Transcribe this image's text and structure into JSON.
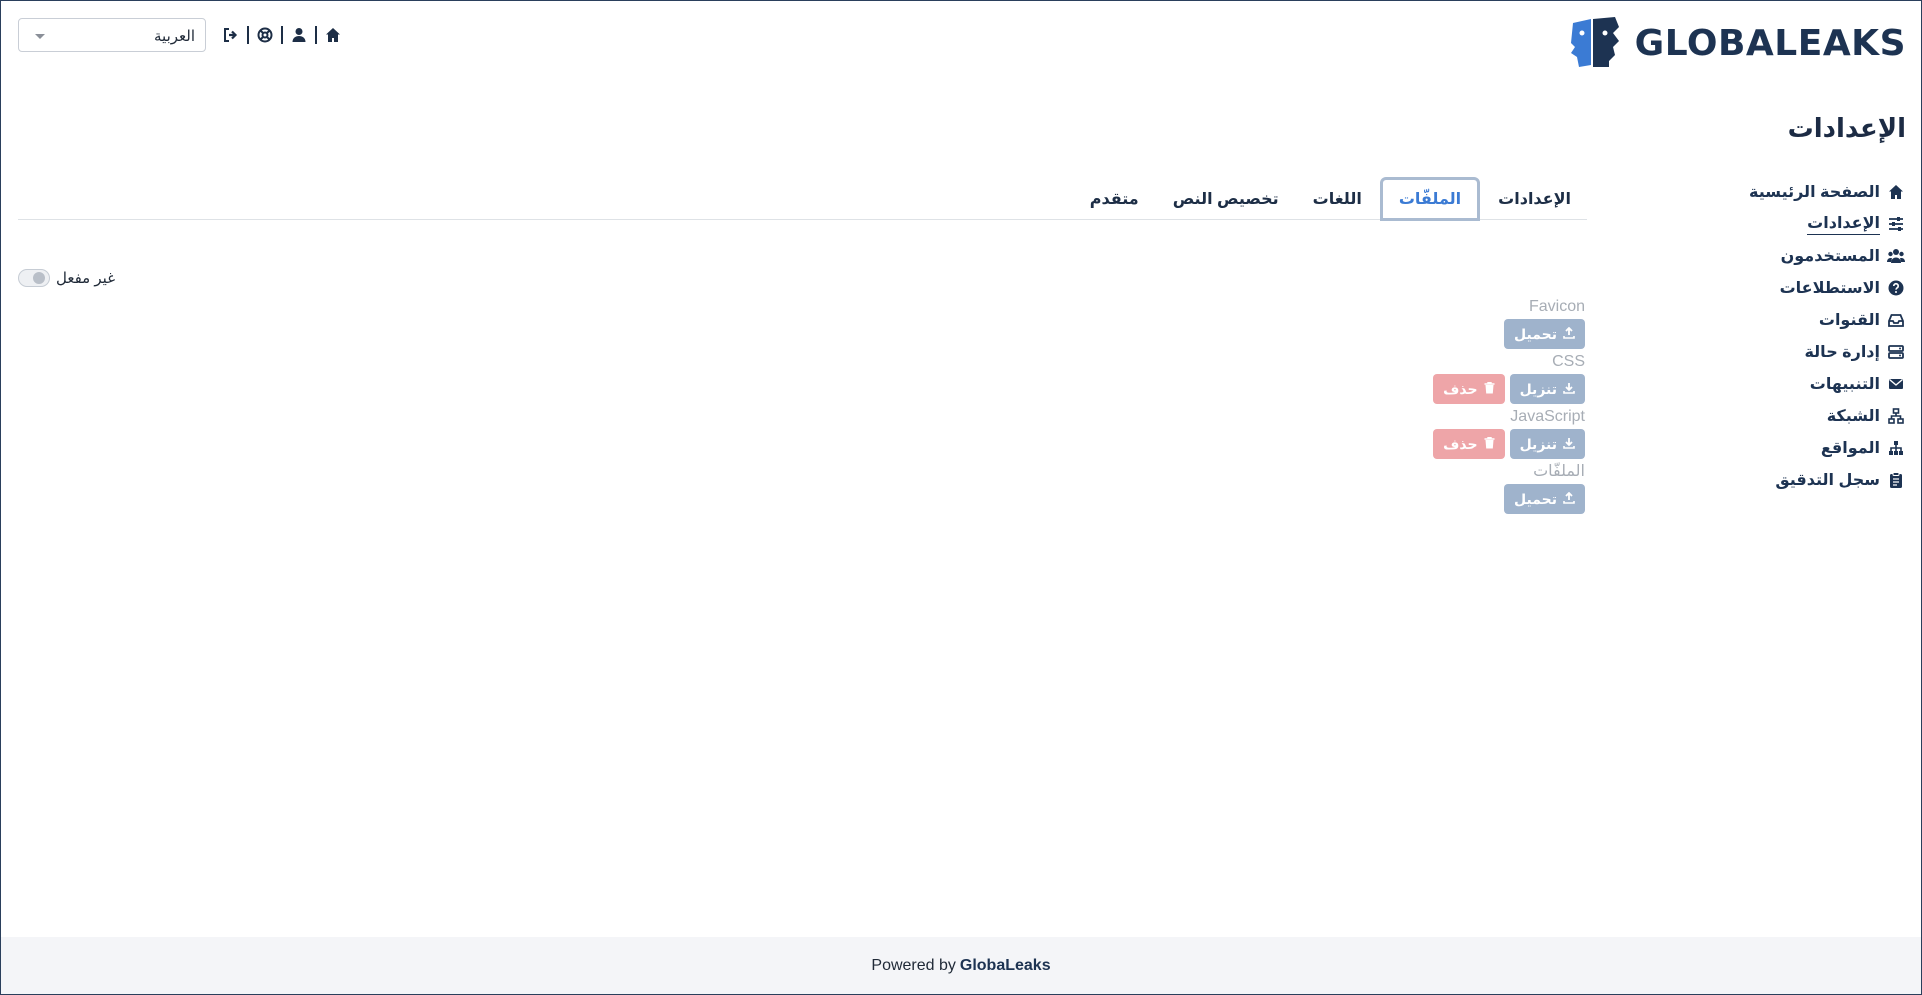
{
  "header": {
    "logo_text": "GLOBALEAKS",
    "language_select": {
      "value": "العربية"
    },
    "nav_icons": [
      "home-icon",
      "user-icon",
      "support-icon",
      "logout-icon"
    ]
  },
  "page_title": "الإعدادات",
  "sidebar": {
    "items": [
      {
        "label": "الصفحة الرئيسية",
        "icon": "home-icon"
      },
      {
        "label": "الإعدادات",
        "icon": "sliders-icon",
        "active": true
      },
      {
        "label": "المستخدمون",
        "icon": "users-icon"
      },
      {
        "label": "الاستطلاعات",
        "icon": "question-icon"
      },
      {
        "label": "القنوات",
        "icon": "inbox-icon"
      },
      {
        "label": "إدارة حالة",
        "icon": "server-icon"
      },
      {
        "label": "التنبيهات",
        "icon": "envelope-icon"
      },
      {
        "label": "الشبكة",
        "icon": "network-icon"
      },
      {
        "label": "المواقع",
        "icon": "sitemap-icon"
      },
      {
        "label": "سجل التدقيق",
        "icon": "clipboard-icon"
      }
    ]
  },
  "tabs": [
    {
      "label": "الإعدادات"
    },
    {
      "label": "الملفّات",
      "active": true
    },
    {
      "label": "اللغات"
    },
    {
      "label": "تخصيص النص"
    },
    {
      "label": "متقدم"
    }
  ],
  "toggle": {
    "label": "غير مفعل",
    "state": "off"
  },
  "files": [
    {
      "label": "Favicon",
      "buttons": [
        {
          "label": "تحميل",
          "icon": "upload-icon",
          "type": "primary"
        }
      ]
    },
    {
      "label": "CSS",
      "buttons": [
        {
          "label": "تنزيل",
          "icon": "download-icon",
          "type": "primary"
        },
        {
          "label": "حذف",
          "icon": "trash-icon",
          "type": "danger"
        }
      ]
    },
    {
      "label": "JavaScript",
      "buttons": [
        {
          "label": "تنزيل",
          "icon": "download-icon",
          "type": "primary"
        },
        {
          "label": "حذف",
          "icon": "trash-icon",
          "type": "danger"
        }
      ]
    },
    {
      "label": "الملفّات",
      "buttons": [
        {
          "label": "تحميل",
          "icon": "upload-icon",
          "type": "primary"
        }
      ]
    }
  ],
  "footer": {
    "prefix": "Powered by",
    "brand": "GlobaLeaks"
  },
  "colors": {
    "brand": "#1d3352",
    "accent": "#3b7bd4",
    "primary_button": "#9fb3cc",
    "danger_button": "#eea5a8"
  }
}
